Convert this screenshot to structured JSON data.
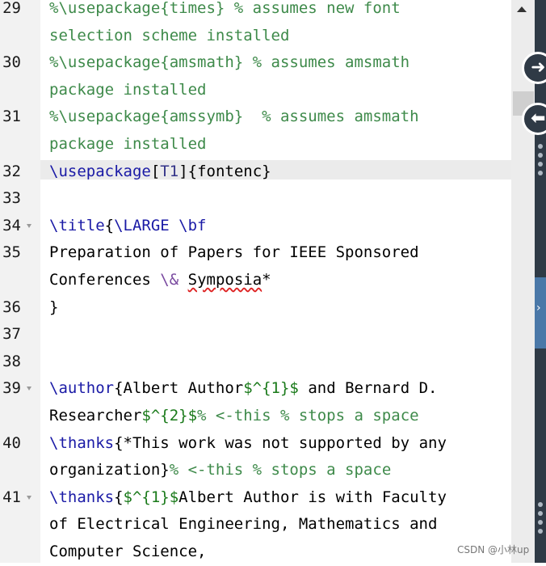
{
  "editor": {
    "lines": [
      {
        "num": "29",
        "fold": false,
        "rows": [
          [
            {
              "c": "cm",
              "t": "%\\usepackage{times} % assumes new font"
            }
          ],
          [
            {
              "c": "cm",
              "t": "selection scheme installed"
            }
          ]
        ]
      },
      {
        "num": "30",
        "fold": false,
        "rows": [
          [
            {
              "c": "cm",
              "t": "%\\usepackage{amsmath} % assumes amsmath"
            }
          ],
          [
            {
              "c": "cm",
              "t": "package installed"
            }
          ]
        ]
      },
      {
        "num": "31",
        "fold": false,
        "rows": [
          [
            {
              "c": "cm",
              "t": "%\\usepackage{amssymb}  % assumes amsmath"
            }
          ],
          [
            {
              "c": "cm",
              "t": "package installed"
            }
          ]
        ]
      },
      {
        "num": "32",
        "fold": false,
        "current": true,
        "rows": [
          [
            {
              "c": "kw",
              "t": "\\usepackage"
            },
            {
              "c": "br",
              "t": "["
            },
            {
              "c": "opt",
              "t": "T1"
            },
            {
              "c": "br",
              "t": "]{fontenc}"
            }
          ]
        ]
      },
      {
        "num": "33",
        "fold": false,
        "rows": [
          []
        ]
      },
      {
        "num": "34",
        "fold": true,
        "rows": [
          [
            {
              "c": "kw",
              "t": "\\title"
            },
            {
              "c": "br",
              "t": "{"
            },
            {
              "c": "kw",
              "t": "\\LARGE \\bf"
            }
          ]
        ]
      },
      {
        "num": "35",
        "fold": false,
        "rows": [
          [
            {
              "c": "br",
              "t": "Preparation of Papers for IEEE Sponsored"
            }
          ],
          [
            {
              "c": "br",
              "t": "Conferences "
            },
            {
              "c": "esc",
              "t": "\\&"
            },
            {
              "c": "br",
              "t": " "
            },
            {
              "c": "sq",
              "t": "Symposia"
            },
            {
              "c": "br",
              "t": "*"
            }
          ]
        ]
      },
      {
        "num": "36",
        "fold": false,
        "rows": [
          [
            {
              "c": "br",
              "t": "}"
            }
          ]
        ]
      },
      {
        "num": "37",
        "fold": false,
        "rows": [
          []
        ]
      },
      {
        "num": "38",
        "fold": false,
        "rows": [
          []
        ]
      },
      {
        "num": "39",
        "fold": true,
        "rows": [
          [
            {
              "c": "kw",
              "t": "\\author"
            },
            {
              "c": "br",
              "t": "{Albert Author"
            },
            {
              "c": "math",
              "t": "$^{1}$"
            },
            {
              "c": "br",
              "t": " and Bernard D."
            }
          ],
          [
            {
              "c": "br",
              "t": "Researcher"
            },
            {
              "c": "math",
              "t": "$^{2}$"
            },
            {
              "c": "cm",
              "t": "% <-this % stops a space"
            }
          ]
        ]
      },
      {
        "num": "40",
        "fold": false,
        "rows": [
          [
            {
              "c": "kw",
              "t": "\\thanks"
            },
            {
              "c": "br",
              "t": "{*This work was not supported by any"
            }
          ],
          [
            {
              "c": "br",
              "t": "organization}"
            },
            {
              "c": "cm",
              "t": "% <-this % stops a space"
            }
          ]
        ]
      },
      {
        "num": "41",
        "fold": true,
        "rows": [
          [
            {
              "c": "kw",
              "t": "\\thanks"
            },
            {
              "c": "br",
              "t": "{"
            },
            {
              "c": "math",
              "t": "$^{1}$"
            },
            {
              "c": "br",
              "t": "Albert Author is with Faculty"
            }
          ],
          [
            {
              "c": "br",
              "t": "of Electrical Engineering, Mathematics and"
            }
          ],
          [
            {
              "c": "br",
              "t": "Computer Science,"
            }
          ]
        ]
      }
    ]
  },
  "nav": {
    "forward_icon": "arrow-right-circle-icon",
    "back_icon": "arrow-left-circle-icon",
    "forward_glyph": "➜",
    "back_glyph": "⬅",
    "collapse_glyph": "›"
  },
  "watermark": "CSDN @小林up"
}
